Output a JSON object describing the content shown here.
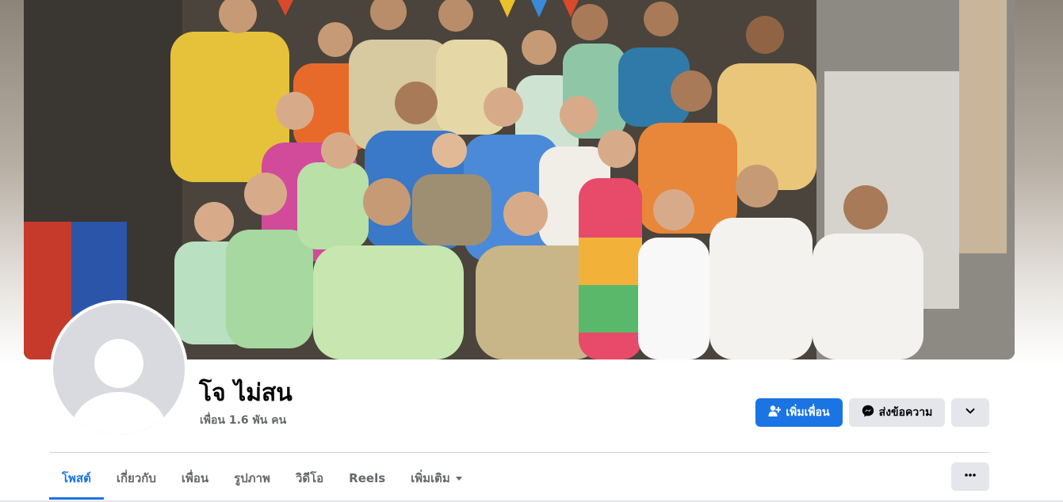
{
  "profile": {
    "name": "โจ ไม่สน",
    "friends_count": "เพื่อน 1.6 พัน คน"
  },
  "actions": {
    "add_friend_label": "เพิ่มเพื่อน",
    "message_label": "ส่งข้อความ"
  },
  "tabs": [
    {
      "label": "โพสต์",
      "active": true
    },
    {
      "label": "เกี่ยวกับ",
      "active": false
    },
    {
      "label": "เพื่อน",
      "active": false
    },
    {
      "label": "รูปภาพ",
      "active": false
    },
    {
      "label": "วิดีโอ",
      "active": false
    },
    {
      "label": "Reels",
      "active": false
    },
    {
      "label": "เพิ่มเติม",
      "active": false
    }
  ],
  "colors": {
    "accent": "#1b74e4",
    "secondary_button": "#e4e6eb",
    "muted_text": "#65676b"
  },
  "icons": {
    "add_friend": "person-plus-icon",
    "message": "messenger-icon",
    "expand": "chevron-down-icon",
    "tab_more": "caret-down-icon",
    "overflow": "ellipsis-icon"
  }
}
